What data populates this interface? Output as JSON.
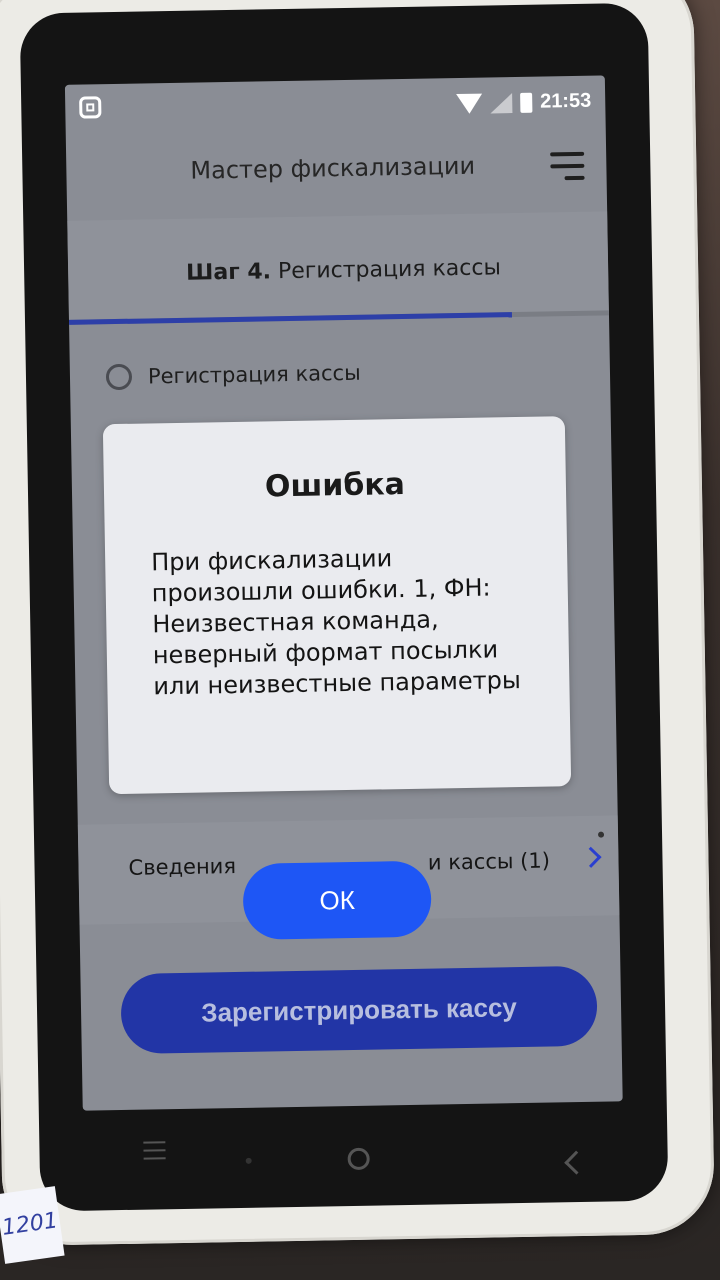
{
  "status_bar": {
    "time": "21:53",
    "icons": [
      "screenshot-icon",
      "wifi-icon",
      "signal-icon",
      "battery-icon"
    ]
  },
  "header": {
    "title": "Мастер фискализации",
    "menu_icon": "hamburger-menu-icon"
  },
  "step": {
    "number_label": "Шаг 4.",
    "title": "Регистрация кассы",
    "progress": 0.82
  },
  "radio_item": {
    "label": "Регистрация кассы",
    "checked": false
  },
  "info_row": {
    "label_left": "Сведения",
    "label_right": "и кассы (1)",
    "chevron": "chevron-right-icon"
  },
  "register_button": {
    "label": "Зарегистрировать кассу"
  },
  "dialog": {
    "title": "Ошибка",
    "message": "При фискализации произошли ошибки. 1, ФН: Неизвестная команда, неверный формат посылки или неизвестные параметры",
    "ok_label": "ОК"
  },
  "sticker": {
    "text": "1201"
  },
  "colors": {
    "primary_blue": "#1e56f5",
    "dimmed_button": "#2235a6",
    "progress": "#2d3fa8",
    "dialog_bg": "#eaebef"
  }
}
